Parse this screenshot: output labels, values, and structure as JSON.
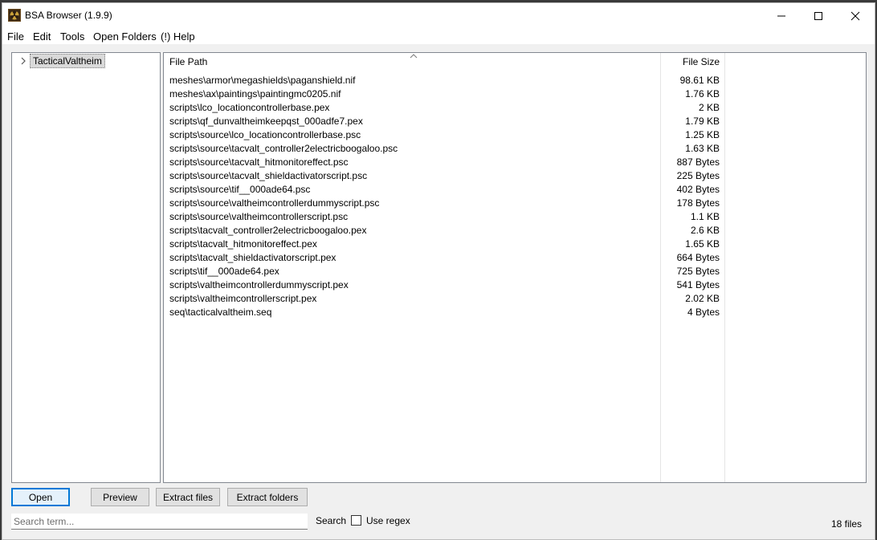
{
  "window": {
    "title": "BSA Browser (1.9.9)"
  },
  "icons": {
    "app": "radiation-icon",
    "minimize": "minimize-icon",
    "maximize": "maximize-icon",
    "close": "close-icon",
    "expand": "chevron-right-icon",
    "sort": "sort-ascending-icon"
  },
  "menu": [
    "File",
    "Edit",
    "Tools",
    "Open Folders",
    "(!) Help"
  ],
  "tree": {
    "root_label": "TacticalValtheim"
  },
  "list": {
    "headers": {
      "path": "File Path",
      "size": "File Size"
    },
    "rows": [
      {
        "path": "meshes\\armor\\megashields\\paganshield.nif",
        "size": "98.61 KB"
      },
      {
        "path": "meshes\\ax\\paintings\\paintingmc0205.nif",
        "size": "1.76 KB"
      },
      {
        "path": "scripts\\lco_locationcontrollerbase.pex",
        "size": "2 KB"
      },
      {
        "path": "scripts\\qf_dunvaltheimkeepqst_000adfe7.pex",
        "size": "1.79 KB"
      },
      {
        "path": "scripts\\source\\lco_locationcontrollerbase.psc",
        "size": "1.25 KB"
      },
      {
        "path": "scripts\\source\\tacvalt_controller2electricboogaloo.psc",
        "size": "1.63 KB"
      },
      {
        "path": "scripts\\source\\tacvalt_hitmonitoreffect.psc",
        "size": "887 Bytes"
      },
      {
        "path": "scripts\\source\\tacvalt_shieldactivatorscript.psc",
        "size": "225 Bytes"
      },
      {
        "path": "scripts\\source\\tif__000ade64.psc",
        "size": "402 Bytes"
      },
      {
        "path": "scripts\\source\\valtheimcontrollerdummyscript.psc",
        "size": "178 Bytes"
      },
      {
        "path": "scripts\\source\\valtheimcontrollerscript.psc",
        "size": "1.1 KB"
      },
      {
        "path": "scripts\\tacvalt_controller2electricboogaloo.pex",
        "size": "2.6 KB"
      },
      {
        "path": "scripts\\tacvalt_hitmonitoreffect.pex",
        "size": "1.65 KB"
      },
      {
        "path": "scripts\\tacvalt_shieldactivatorscript.pex",
        "size": "664 Bytes"
      },
      {
        "path": "scripts\\tif__000ade64.pex",
        "size": "725 Bytes"
      },
      {
        "path": "scripts\\valtheimcontrollerdummyscript.pex",
        "size": "541 Bytes"
      },
      {
        "path": "scripts\\valtheimcontrollerscript.pex",
        "size": "2.02 KB"
      },
      {
        "path": "seq\\tacticalvaltheim.seq",
        "size": "4 Bytes"
      }
    ]
  },
  "buttons": {
    "open": "Open",
    "preview": "Preview",
    "extract_files": "Extract files",
    "extract_folders": "Extract folders"
  },
  "search": {
    "placeholder": "Search term...",
    "value": "",
    "search_label": "Search",
    "regex_label": "Use regex",
    "regex_checked": false
  },
  "status": {
    "file_count": "18 files"
  },
  "colors": {
    "accent": "#0078d7",
    "selection": "#d9d9d9"
  }
}
